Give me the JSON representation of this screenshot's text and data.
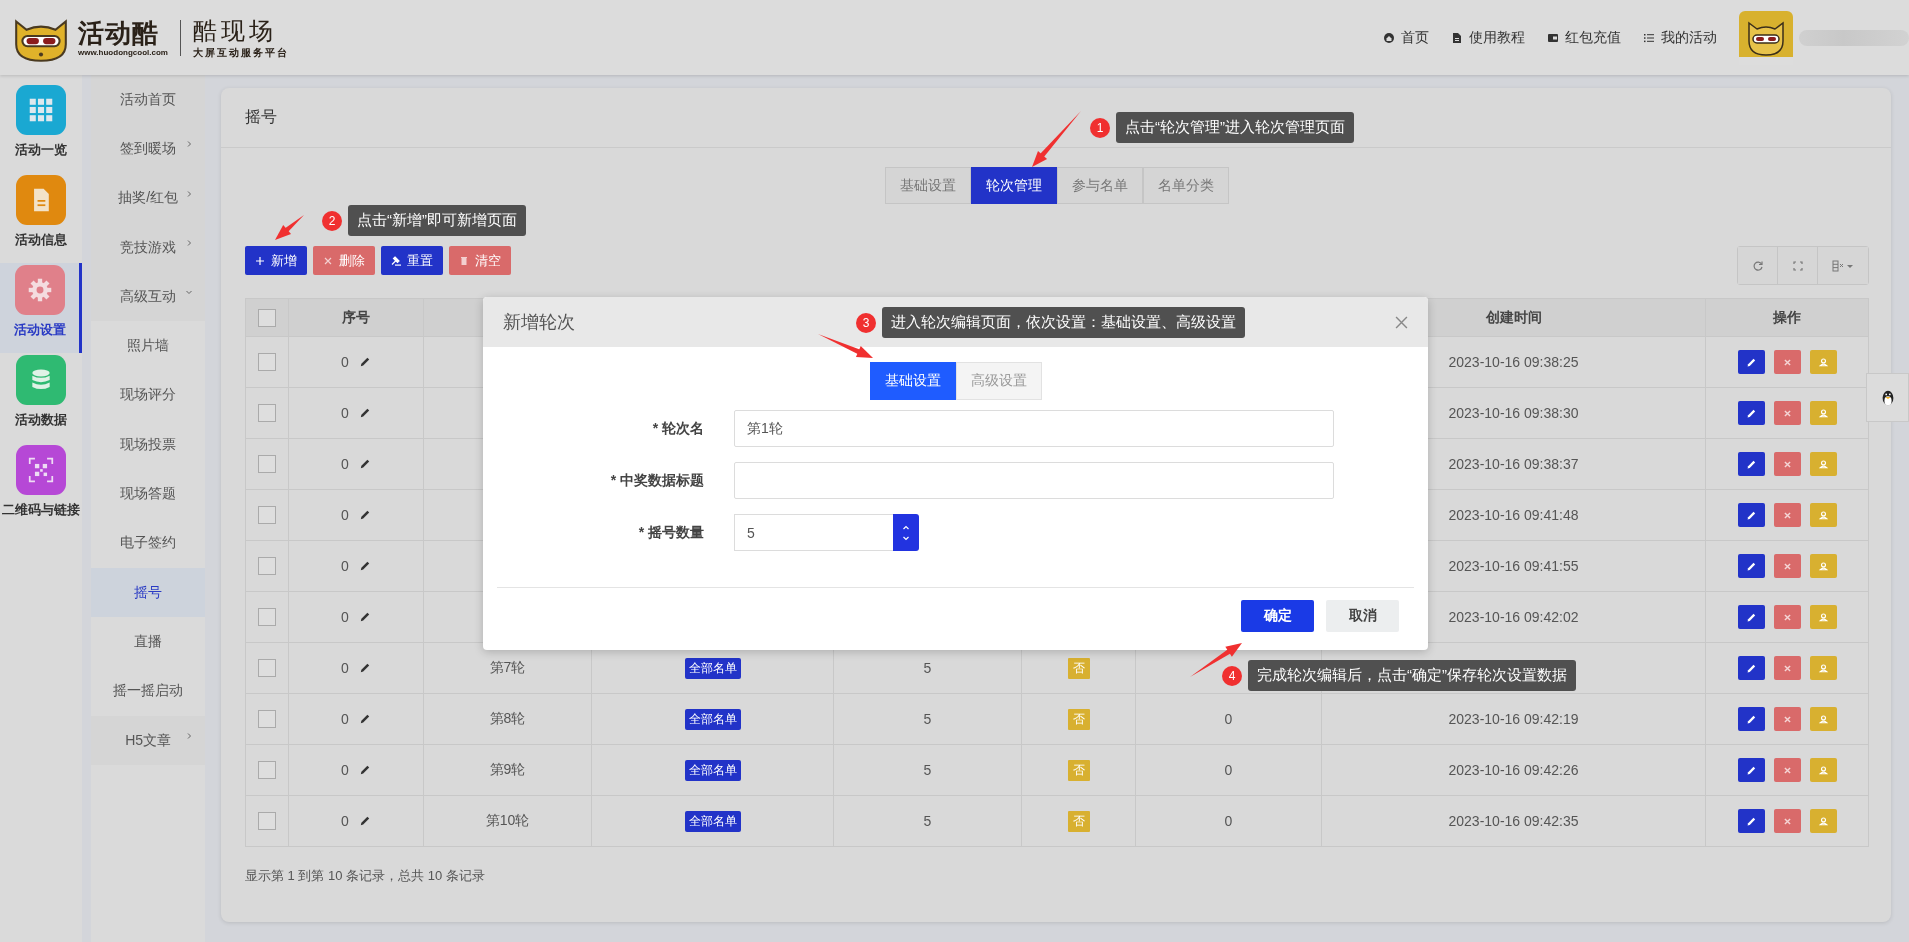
{
  "header": {
    "logo": {
      "brand": "活动酷",
      "url": "www.huodongcool.com",
      "product": "酷现场",
      "slogan": "大屏互动服务平台"
    },
    "nav": [
      {
        "label": "首页",
        "kind": "home"
      },
      {
        "label": "使用教程",
        "kind": "doc"
      },
      {
        "label": "红包充值",
        "kind": "wallet"
      },
      {
        "label": "我的活动",
        "kind": "list"
      }
    ]
  },
  "rail": [
    {
      "label": "活动一览",
      "kind": "grid",
      "color": "#1aa8d2",
      "selected": false
    },
    {
      "label": "活动信息",
      "kind": "doc",
      "color": "#e0890f",
      "selected": false
    },
    {
      "label": "活动设置",
      "kind": "gear",
      "color": "#e0808a",
      "selected": true
    },
    {
      "label": "活动数据",
      "kind": "data",
      "color": "#2fba72",
      "selected": false
    },
    {
      "label": "二维码与链接",
      "kind": "qr",
      "color": "#b648d6",
      "selected": false
    }
  ],
  "submenu": [
    {
      "label": "活动首页",
      "selected": false
    },
    {
      "label": "签到暖场",
      "selected": false,
      "expanded": false
    },
    {
      "label": "抽奖/红包",
      "selected": false,
      "expanded": false
    },
    {
      "label": "竞技游戏",
      "selected": false,
      "expanded": false
    },
    {
      "label": "高级互动",
      "selected": false,
      "expanded": true,
      "children": [
        {
          "label": "照片墙",
          "selected": false
        },
        {
          "label": "现场评分",
          "selected": false
        },
        {
          "label": "现场投票",
          "selected": false
        },
        {
          "label": "现场答题",
          "selected": false
        },
        {
          "label": "电子签约",
          "selected": false
        },
        {
          "label": "摇号",
          "selected": true
        },
        {
          "label": "直播",
          "selected": false
        },
        {
          "label": "摇一摇启动",
          "selected": false
        }
      ]
    },
    {
      "label": "H5文章",
      "selected": false,
      "expanded": false
    }
  ],
  "card": {
    "title": "摇号",
    "tabs": [
      {
        "label": "基础设置",
        "selected": false
      },
      {
        "label": "轮次管理",
        "selected": true
      },
      {
        "label": "参与名单",
        "selected": false
      },
      {
        "label": "名单分类",
        "selected": false
      }
    ],
    "toolbar": [
      {
        "label": "新增",
        "kind": "add"
      },
      {
        "label": "删除",
        "kind": "delete"
      },
      {
        "label": "重置",
        "kind": "reset"
      },
      {
        "label": "清空",
        "kind": "clear"
      }
    ],
    "table": {
      "header_checked": false,
      "columns": {
        "seq": "序号",
        "created": "创建时间",
        "actions": "操作"
      },
      "rows": [
        {
          "checked": false,
          "seq": "0",
          "created": "2023-10-16 09:38:25"
        },
        {
          "checked": false,
          "seq": "0",
          "created": "2023-10-16 09:38:30"
        },
        {
          "checked": false,
          "seq": "0",
          "created": "2023-10-16 09:38:37"
        },
        {
          "checked": false,
          "seq": "0",
          "created": "2023-10-16 09:41:48"
        },
        {
          "checked": false,
          "seq": "0",
          "created": "2023-10-16 09:41:55"
        },
        {
          "checked": false,
          "seq": "0",
          "created": "2023-10-16 09:42:02"
        },
        {
          "checked": false,
          "seq": "0",
          "column_3": "第7轮",
          "column_4": "全部名单",
          "column_5": "5",
          "column_6": "否"
        },
        {
          "checked": false,
          "seq": "0",
          "column_3": "第8轮",
          "column_4": "全部名单",
          "column_5": "5",
          "column_6": "否",
          "column_7": "0",
          "created": "2023-10-16 09:42:19"
        },
        {
          "checked": false,
          "seq": "0",
          "column_3": "第9轮",
          "column_4": "全部名单",
          "column_5": "5",
          "column_6": "否",
          "column_7": "0",
          "created": "2023-10-16 09:42:26"
        },
        {
          "checked": false,
          "seq": "0",
          "column_3": "第10轮",
          "column_4": "全部名单",
          "column_5": "5",
          "column_6": "否",
          "column_7": "0",
          "created": "2023-10-16 09:42:35"
        }
      ]
    },
    "footer": "显示第 1 到第 10 条记录，总共 10 条记录"
  },
  "modal": {
    "title": "新增轮次",
    "tabs": [
      {
        "label": "基础设置",
        "selected": true
      },
      {
        "label": "高级设置",
        "selected": false
      }
    ],
    "fields": [
      {
        "label": "* 轮次名",
        "kind": "text",
        "value": "第1轮"
      },
      {
        "label": "* 中奖数据标题",
        "kind": "text"
      },
      {
        "label": "* 摇号数量",
        "kind": "number",
        "value": "5"
      }
    ],
    "buttons": [
      {
        "label": "确定",
        "kind": "primary"
      },
      {
        "label": "取消",
        "kind": "secondary"
      }
    ]
  },
  "annotations": [
    {
      "number": "1",
      "text": "点击“轮次管理”进入轮次管理页面"
    },
    {
      "number": "2",
      "text": "点击“新增”即可新增页面"
    },
    {
      "number": "3",
      "text": "进入轮次编辑页面，依次设置：基础设置、高级设置"
    },
    {
      "number": "4",
      "text": "完成轮次编辑后，点击“确定”保存轮次设置数据"
    }
  ]
}
